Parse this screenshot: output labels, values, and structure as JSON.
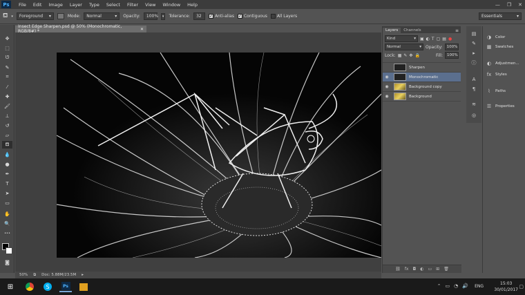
{
  "menubar": {
    "logo": "Ps",
    "items": [
      "File",
      "Edit",
      "Image",
      "Layer",
      "Type",
      "Select",
      "Filter",
      "View",
      "Window",
      "Help"
    ]
  },
  "options": {
    "sample": "Foreground",
    "mode_label": "Mode:",
    "mode_value": "Normal",
    "opacity_label": "Opacity:",
    "opacity_value": "100%",
    "tolerance_label": "Tolerance:",
    "tolerance_value": "32",
    "antialias_label": "Anti-alias",
    "contiguous_label": "Contiguous",
    "all_layers_label": "All Layers",
    "workspace": "Essentials"
  },
  "document": {
    "tab_title": "Insect Edge Sharpen.psd @ 50% (Monochromatic, RGB/8#) *",
    "zoom": "50%",
    "doc_size": "Doc: 5.88M/23.5M"
  },
  "layers_panel": {
    "tabs": [
      "Layers",
      "Channels"
    ],
    "filter_kind": "Kind",
    "blend_mode": "Normal",
    "opacity_label": "Opacity:",
    "opacity_value": "100%",
    "lock_label": "Lock:",
    "fill_label": "Fill:",
    "fill_value": "100%",
    "layers": [
      {
        "name": "Sharpen",
        "visible": false,
        "selected": false
      },
      {
        "name": "Monochromatic",
        "visible": true,
        "selected": true
      },
      {
        "name": "Background copy",
        "visible": true,
        "selected": false
      },
      {
        "name": "Background",
        "visible": true,
        "selected": false
      }
    ]
  },
  "right_panels": {
    "items": [
      "Color",
      "Swatches",
      "Adjustmen...",
      "Styles",
      "Paths",
      "Properties"
    ]
  },
  "taskbar": {
    "language": "ENG",
    "time": "15:03",
    "date": "30/01/2017"
  }
}
